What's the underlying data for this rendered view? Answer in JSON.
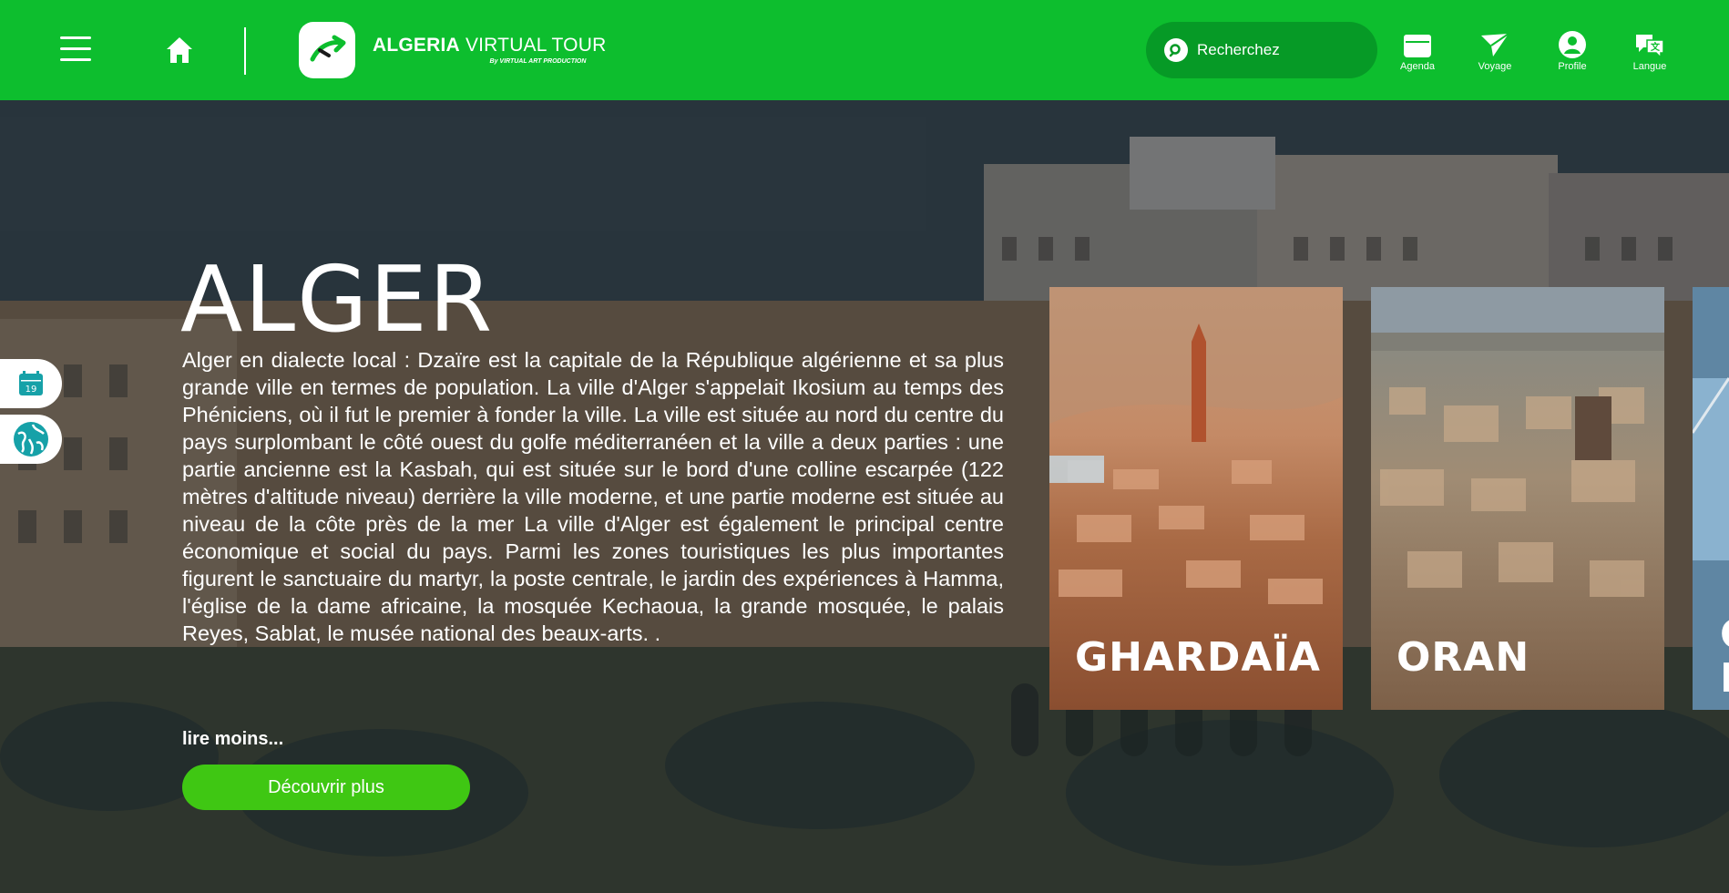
{
  "header": {
    "menu_icon": "hamburger-menu-icon",
    "home_icon": "home-icon",
    "logo": {
      "title_bold": "ALGERIA",
      "title_rest": " VIRTUAL TOUR",
      "subtitle": "By VIRTUAL ART PRODUCTION"
    },
    "search": {
      "placeholder": "Recherchez",
      "icon": "search-icon"
    },
    "nav": [
      {
        "label": "Agenda",
        "icon": "calendar-icon"
      },
      {
        "label": "Voyage",
        "icon": "paper-plane-icon"
      },
      {
        "label": "Profile",
        "icon": "user-icon"
      },
      {
        "label": "Langue",
        "icon": "language-icon"
      }
    ],
    "accent_color": "#0dbe2e"
  },
  "side_tabs": [
    {
      "icon": "calendar-icon",
      "day": "19"
    },
    {
      "icon": "globe-icon"
    }
  ],
  "hero": {
    "title": "ALGER",
    "description": "Alger en dialecte local : Dzaïre est la capitale de la République algérienne et sa plus grande ville en termes de population. La ville d'Alger s'appelait Ikosium au temps des Phéniciens, où il fut le premier à fonder la ville. La ville est située au nord du centre du pays surplombant le côté ouest du golfe méditerranéen et la ville a deux parties : une partie ancienne est la Kasbah, qui est située sur le bord d'une colline escarpée (122 mètres d'altitude niveau) derrière la ville moderne, et une partie moderne est située au niveau de la côte près de la mer La ville d'Alger est également le principal centre économique et social du pays. Parmi les zones touristiques les plus importantes figurent le sanctuaire du martyr, la poste centrale, le jardin des expériences à Hamma, l'église de la dame africaine, la mosquée Kechaoua, la grande mosquée, le palais Reyes, Sablat, le musée national des beaux-arts. .",
    "read_less": "lire moins...",
    "cta": "Découvrir plus",
    "cta_color": "#3fc713"
  },
  "cards": [
    {
      "label": "GHARDAÏA"
    },
    {
      "label": "ORAN"
    },
    {
      "label": "C\nI"
    }
  ]
}
